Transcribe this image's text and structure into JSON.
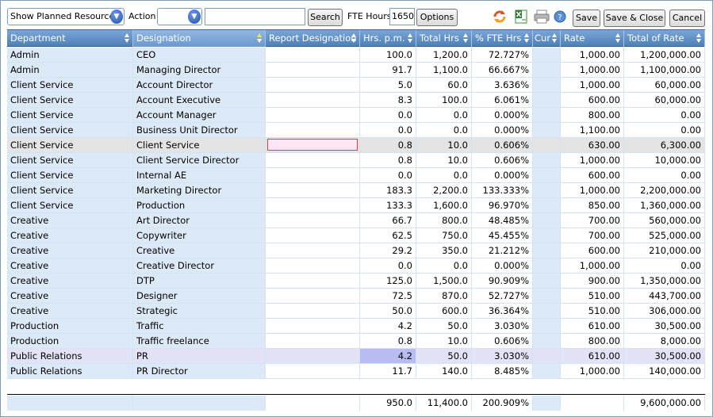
{
  "toolbar": {
    "view_select": "Show Planned Resources",
    "action_label": "Action",
    "action_select": "",
    "search_value": "",
    "search_label": "Search",
    "fte_label": "FTE Hours",
    "fte_value": "1650",
    "options_label": "Options",
    "save_label": "Save",
    "save_close_label": "Save & Close",
    "cancel_label": "Cancel",
    "icons": [
      "refresh-icon",
      "excel-export-icon",
      "print-icon",
      "help-icon"
    ]
  },
  "grid": {
    "columns": [
      "Department",
      "Designation",
      "Report Designation",
      "Hrs. p.m.",
      "Total Hrs",
      "% FTE Hrs",
      "Cur",
      "Rate",
      "Total of Rate"
    ],
    "rows": [
      [
        "Admin",
        "CEO",
        "",
        "100.0",
        "1,200.0",
        "72.727%",
        "",
        "1,000.00",
        "1,200,000.00"
      ],
      [
        "Admin",
        "Managing Director",
        "",
        "91.7",
        "1,100.0",
        "66.667%",
        "",
        "1,000.00",
        "1,100,000.00"
      ],
      [
        "Client Service",
        "Account Director",
        "",
        "5.0",
        "60.0",
        "3.636%",
        "",
        "1,000.00",
        "60,000.00"
      ],
      [
        "Client Service",
        "Account Executive",
        "",
        "8.3",
        "100.0",
        "6.061%",
        "",
        "600.00",
        "60,000.00"
      ],
      [
        "Client Service",
        "Account Manager",
        "",
        "0.0",
        "0.0",
        "0.000%",
        "",
        "800.00",
        "0.00"
      ],
      [
        "Client Service",
        "Business Unit Director",
        "",
        "0.0",
        "0.0",
        "0.000%",
        "",
        "1,100.00",
        "0.00"
      ],
      [
        "Client Service",
        "Client Service",
        "",
        "0.8",
        "10.0",
        "0.606%",
        "",
        "630.00",
        "6,300.00"
      ],
      [
        "Client Service",
        "Client Service Director",
        "",
        "0.8",
        "10.0",
        "0.606%",
        "",
        "1,000.00",
        "10,000.00"
      ],
      [
        "Client Service",
        "Internal AE",
        "",
        "0.0",
        "0.0",
        "0.000%",
        "",
        "600.00",
        "0.00"
      ],
      [
        "Client Service",
        "Marketing Director",
        "",
        "183.3",
        "2,200.0",
        "133.333%",
        "",
        "1,000.00",
        "2,200,000.00"
      ],
      [
        "Client Service",
        "Production",
        "",
        "133.3",
        "1,600.0",
        "96.970%",
        "",
        "850.00",
        "1,360,000.00"
      ],
      [
        "Creative",
        "Art Director",
        "",
        "66.7",
        "800.0",
        "48.485%",
        "",
        "700.00",
        "560,000.00"
      ],
      [
        "Creative",
        "Copywriter",
        "",
        "62.5",
        "750.0",
        "45.455%",
        "",
        "700.00",
        "525,000.00"
      ],
      [
        "Creative",
        "Creative",
        "",
        "29.2",
        "350.0",
        "21.212%",
        "",
        "600.00",
        "210,000.00"
      ],
      [
        "Creative",
        "Creative Director",
        "",
        "0.0",
        "0.0",
        "0.000%",
        "",
        "1,000.00",
        "0.00"
      ],
      [
        "Creative",
        "DTP",
        "",
        "125.0",
        "1,500.0",
        "90.909%",
        "",
        "900.00",
        "1,350,000.00"
      ],
      [
        "Creative",
        "Designer",
        "",
        "72.5",
        "870.0",
        "52.727%",
        "",
        "510.00",
        "443,700.00"
      ],
      [
        "Creative",
        "Strategic",
        "",
        "50.0",
        "600.0",
        "36.364%",
        "",
        "510.00",
        "306,000.00"
      ],
      [
        "Production",
        "Traffic",
        "",
        "4.2",
        "50.0",
        "3.030%",
        "",
        "610.00",
        "30,500.00"
      ],
      [
        "Production",
        "Traffic freelance",
        "",
        "0.8",
        "10.0",
        "0.606%",
        "",
        "800.00",
        "8,000.00"
      ],
      [
        "Public Relations",
        "PR",
        "",
        "4.2",
        "50.0",
        "3.030%",
        "",
        "610.00",
        "30,500.00"
      ],
      [
        "Public Relations",
        "PR Director",
        "",
        "11.7",
        "140.0",
        "8.485%",
        "",
        "1,000.00",
        "140,000.00"
      ]
    ],
    "selected_row": 6,
    "hover_row": 20,
    "totals": [
      "",
      "",
      "",
      "950.0",
      "11,400.0",
      "200.909%",
      "",
      "",
      "9,600,000.00"
    ]
  }
}
